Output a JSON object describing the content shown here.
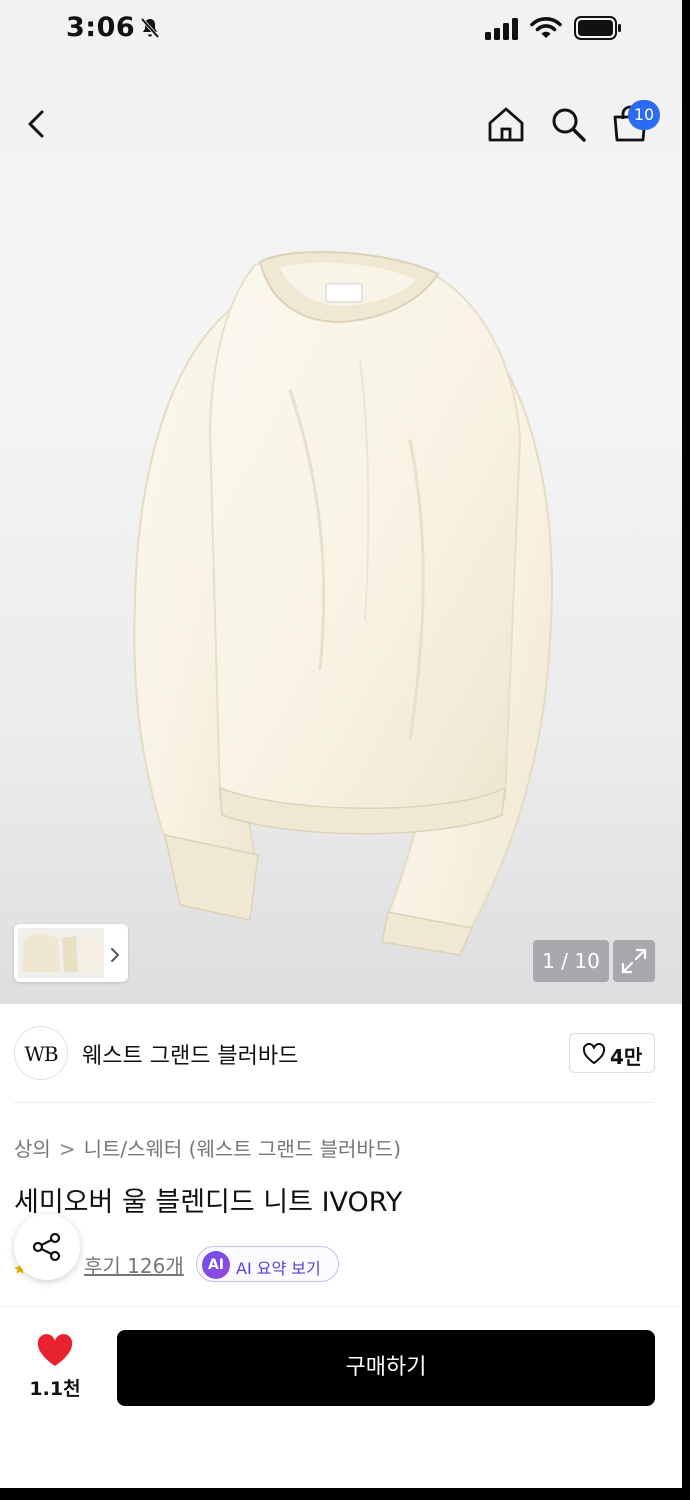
{
  "status_bar": {
    "time": "3:06"
  },
  "nav": {
    "cart_badge": "10"
  },
  "gallery": {
    "counter": "1 / 10"
  },
  "brand": {
    "logo_text": "WB",
    "name": "웨스트 그랜드 블러바드",
    "like_count": "4만"
  },
  "breadcrumb": {
    "level1": "상의",
    "separator": ">",
    "level2": "니트/스웨터 (웨스트 그랜드 블러바드)"
  },
  "product": {
    "title": "세미오버 울 블렌디드 니트 IVORY"
  },
  "reviews": {
    "label": "후기 126개"
  },
  "ai_summary": {
    "badge": "AI",
    "label": "AI 요약 보기"
  },
  "bottom_bar": {
    "wish_count": "1.1천",
    "buy_label": "구매하기"
  },
  "colors": {
    "accent_blue": "#2b6bf3",
    "heart_red": "#e8232f",
    "ai_purple": "#6a4ff0",
    "buy_black": "#000000"
  },
  "icons": [
    "bell-off-icon",
    "signal-icon",
    "wifi-icon",
    "battery-icon",
    "back-icon",
    "home-icon",
    "search-icon",
    "cart-icon",
    "expand-icon",
    "heart-outline-icon",
    "share-icon",
    "heart-filled-icon"
  ]
}
